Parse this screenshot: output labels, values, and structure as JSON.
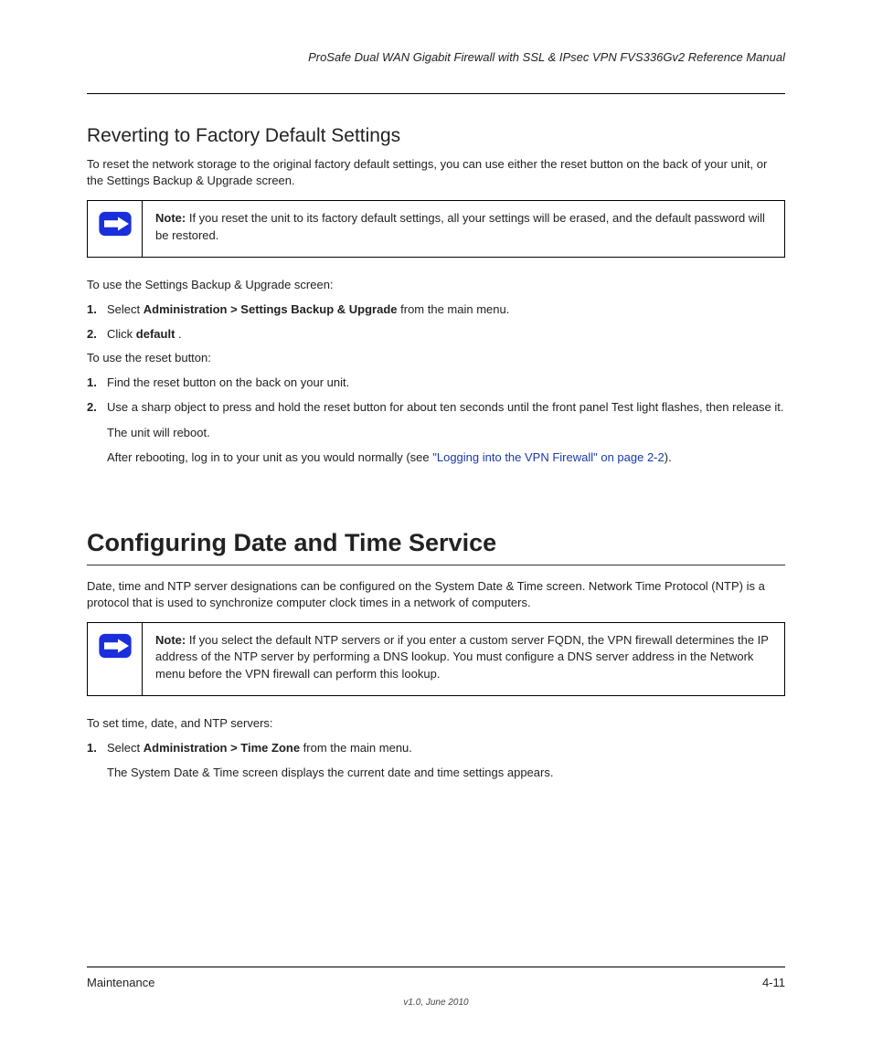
{
  "header": {
    "title": "ProSafe Dual WAN Gigabit Firewall with SSL & IPsec VPN FVS336Gv2 Reference Manual"
  },
  "section": {
    "title": "Reverting to Factory Default Settings",
    "intro": "To reset the network storage to the original factory default settings, you can use either the reset button on the back of your unit, or the Settings Backup & Upgrade screen.",
    "note1_label": "Note:",
    "note1_text": " If you reset the unit to its factory default settings, all your settings will be erased, and the default password will be restored.",
    "steps_lead": "To use the Settings Backup & Upgrade screen:",
    "steps": [
      {
        "num": "1.",
        "text_pre": "Select",
        "text_strong": "Administration > Settings Backup & Upgrade",
        "text_post": " from the main menu."
      },
      {
        "num": "2.",
        "text_pre": "Click ",
        "text_strong": "default",
        "text_post": "."
      }
    ],
    "reset_lead": "To use the reset button:",
    "reset_steps": [
      {
        "num": "1.",
        "text": "Find the reset button on the back on your unit."
      },
      {
        "num": "2.",
        "text": "Use a sharp object to press and hold the reset button for about ten seconds until the front panel Test light flashes, then release it."
      }
    ],
    "reset_outro_1": "The unit will reboot.",
    "reset_outro_2": "After rebooting, log in to your unit as you would normally (see ",
    "reset_outro_link": "\"Logging into the VPN Firewall\" on page 2-2",
    "reset_outro_3": ")."
  },
  "heading2": "Configuring Date and Time Service",
  "para2": "Date, time and NTP server designations can be configured on the System Date & Time screen. Network Time Protocol (NTP) is a protocol that is used to synchronize computer clock times in a network of computers.",
  "note2_label": "Note:",
  "note2_text": " If you select the default NTP servers or if you enter a custom server FQDN, the VPN firewall determines the IP address of the NTP server by performing a DNS lookup. You must configure a DNS server address in the Network menu before the VPN firewall can perform this lookup.",
  "after_note2": "To set time, date, and NTP servers:",
  "step2": [
    {
      "num": "1.",
      "text_pre": "Select ",
      "text_strong": "Administration > Time Zone",
      "text_post": " from the main menu."
    }
  ],
  "step2_after": "The System Date & Time screen displays the current date and time settings appears.",
  "footer": {
    "left": "Maintenance",
    "right": "4-11",
    "center": "v1.0, June 2010"
  }
}
